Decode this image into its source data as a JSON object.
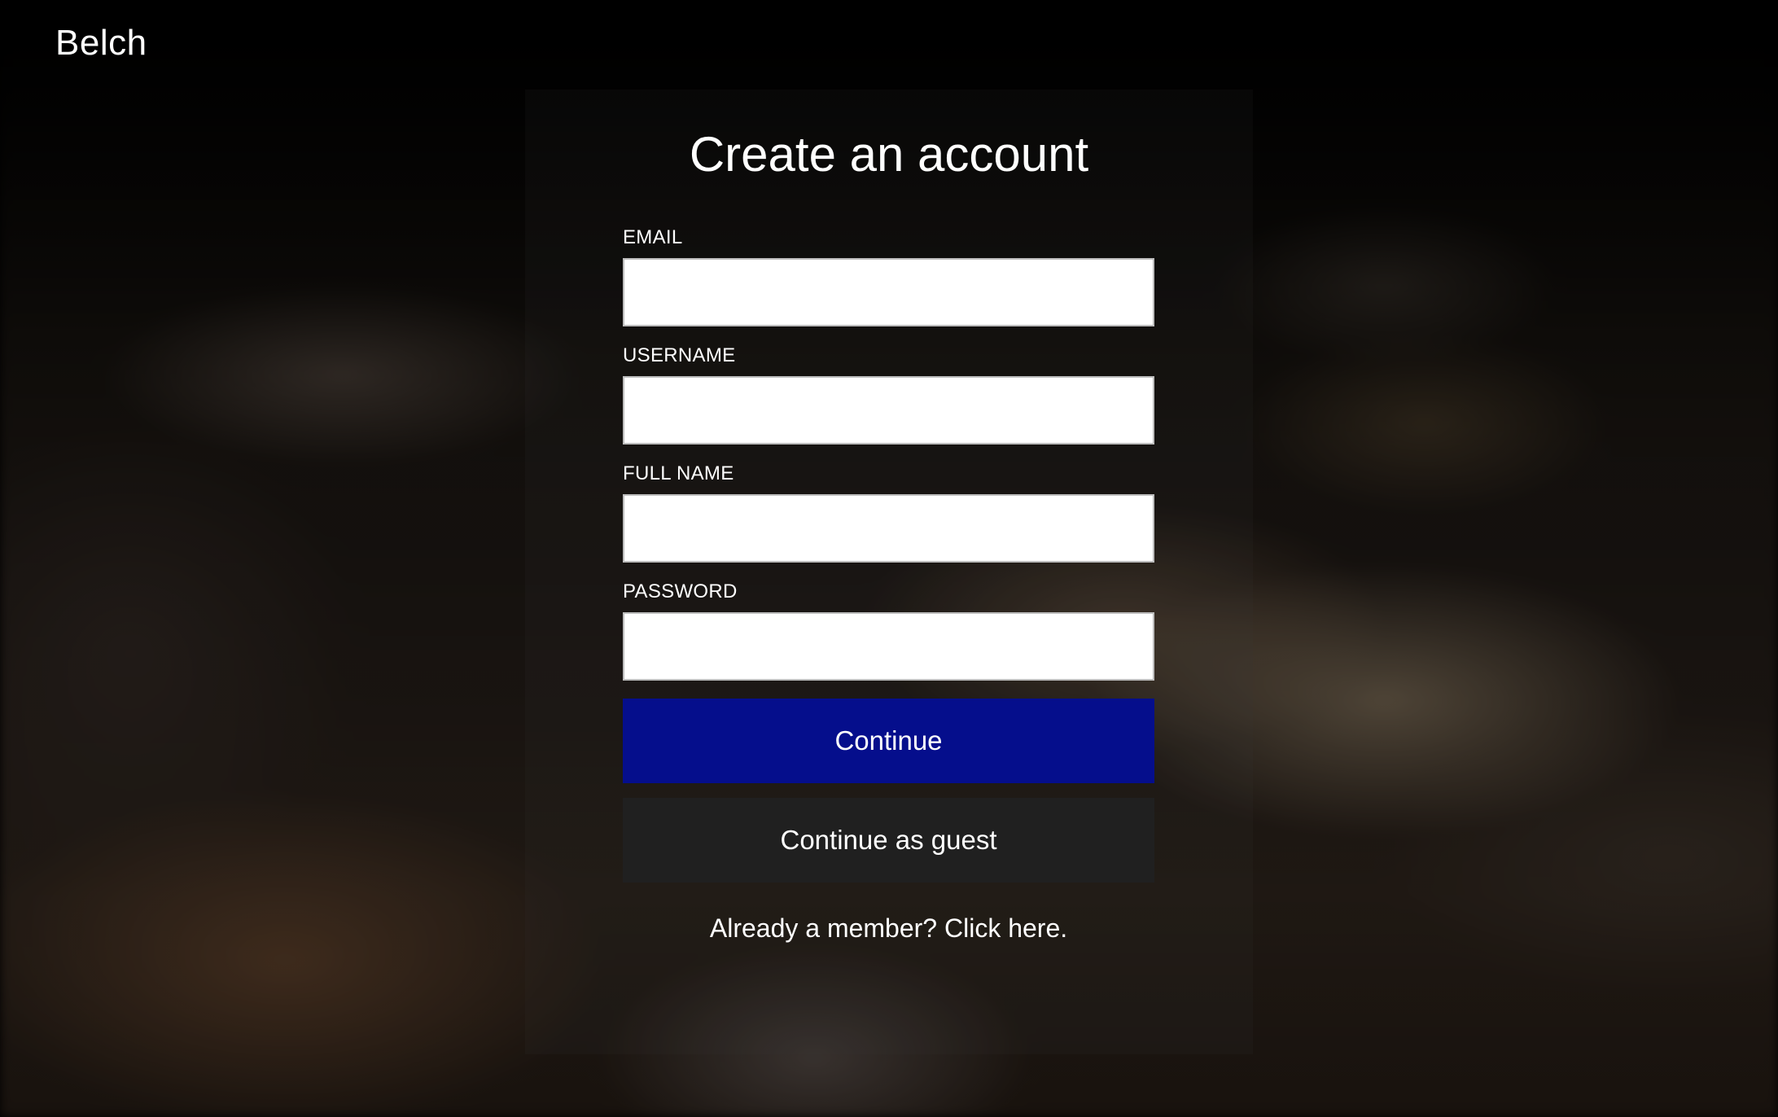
{
  "app": {
    "brand": "Belch"
  },
  "signup": {
    "title": "Create an account",
    "fields": [
      {
        "label": "EMAIL",
        "value": "",
        "placeholder": ""
      },
      {
        "label": "USERNAME",
        "value": "",
        "placeholder": ""
      },
      {
        "label": "FULL NAME",
        "value": "",
        "placeholder": ""
      },
      {
        "label": "PASSWORD",
        "value": "",
        "placeholder": ""
      }
    ],
    "continue_label": "Continue",
    "guest_label": "Continue as guest",
    "login_prompt": "Already a member? Click here."
  },
  "colors": {
    "primary_button": "#050e8c",
    "secondary_button": "#202020",
    "text": "#ffffff",
    "background": "#000000"
  }
}
